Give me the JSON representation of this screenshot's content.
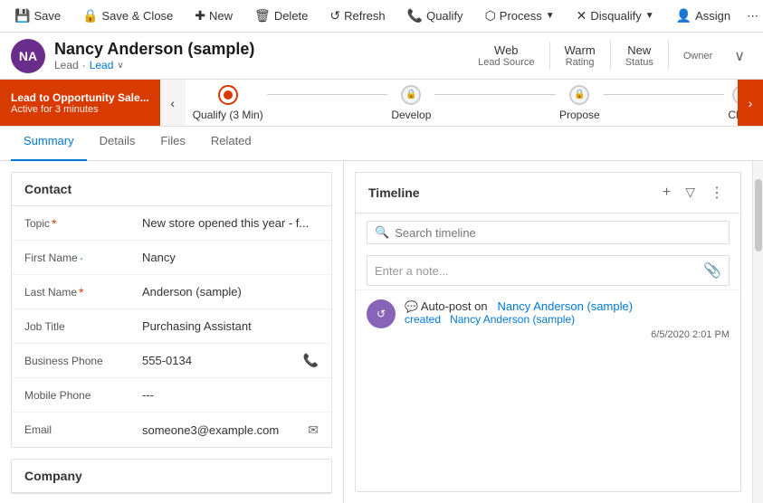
{
  "toolbar": {
    "save_label": "Save",
    "save_close_label": "Save & Close",
    "new_label": "New",
    "delete_label": "Delete",
    "refresh_label": "Refresh",
    "qualify_label": "Qualify",
    "process_label": "Process",
    "disqualify_label": "Disqualify",
    "assign_label": "Assign",
    "more_icon": "⋯"
  },
  "header": {
    "avatar_initials": "NA",
    "name": "Nancy Anderson (sample)",
    "type": "Lead",
    "type_link": "Lead",
    "chevron_icon": "∨",
    "fields": [
      {
        "value": "Web",
        "label": "Lead Source"
      },
      {
        "value": "Warm",
        "label": "Rating"
      },
      {
        "value": "New",
        "label": "Status"
      },
      {
        "value": "",
        "label": "Owner"
      }
    ]
  },
  "stage_bar": {
    "promo_title": "Lead to Opportunity Sale...",
    "promo_sub": "Active for 3 minutes",
    "nav_left_icon": "‹",
    "nav_right_icon": "›",
    "stages": [
      {
        "label": "Qualify (3 Min)",
        "state": "active",
        "locked": false
      },
      {
        "label": "Develop",
        "state": "future",
        "locked": true
      },
      {
        "label": "Propose",
        "state": "future",
        "locked": true
      },
      {
        "label": "Close",
        "state": "future",
        "locked": true
      }
    ]
  },
  "tabs": [
    {
      "label": "Summary",
      "active": true
    },
    {
      "label": "Details",
      "active": false
    },
    {
      "label": "Files",
      "active": false
    },
    {
      "label": "Related",
      "active": false
    }
  ],
  "contact_section": {
    "title": "Contact",
    "fields": [
      {
        "label": "Topic",
        "required": true,
        "value": "New store opened this year - f...",
        "action": null
      },
      {
        "label": "First Name",
        "required": false,
        "optional": true,
        "value": "Nancy",
        "action": null
      },
      {
        "label": "Last Name",
        "required": true,
        "value": "Anderson (sample)",
        "action": null
      },
      {
        "label": "Job Title",
        "required": false,
        "value": "Purchasing Assistant",
        "action": null
      },
      {
        "label": "Business Phone",
        "required": false,
        "value": "555-0134",
        "action": "phone"
      },
      {
        "label": "Mobile Phone",
        "required": false,
        "value": "---",
        "action": null
      },
      {
        "label": "Email",
        "required": false,
        "value": "someone3@example.com",
        "action": "email"
      }
    ]
  },
  "company_section": {
    "title": "Company"
  },
  "timeline": {
    "title": "Timeline",
    "add_icon": "+",
    "filter_icon": "⧖",
    "more_icon": "⋮",
    "search_placeholder": "Search timeline",
    "note_placeholder": "Enter a note...",
    "attach_icon": "📎",
    "entries": [
      {
        "avatar": "⟳",
        "title_prefix": "Auto-post on",
        "title_entity": "Nancy Anderson (sample)",
        "sub_prefix": "created",
        "sub_entity": "Nancy Anderson (sample)",
        "timestamp": "6/5/2020 2:01 PM"
      }
    ]
  }
}
